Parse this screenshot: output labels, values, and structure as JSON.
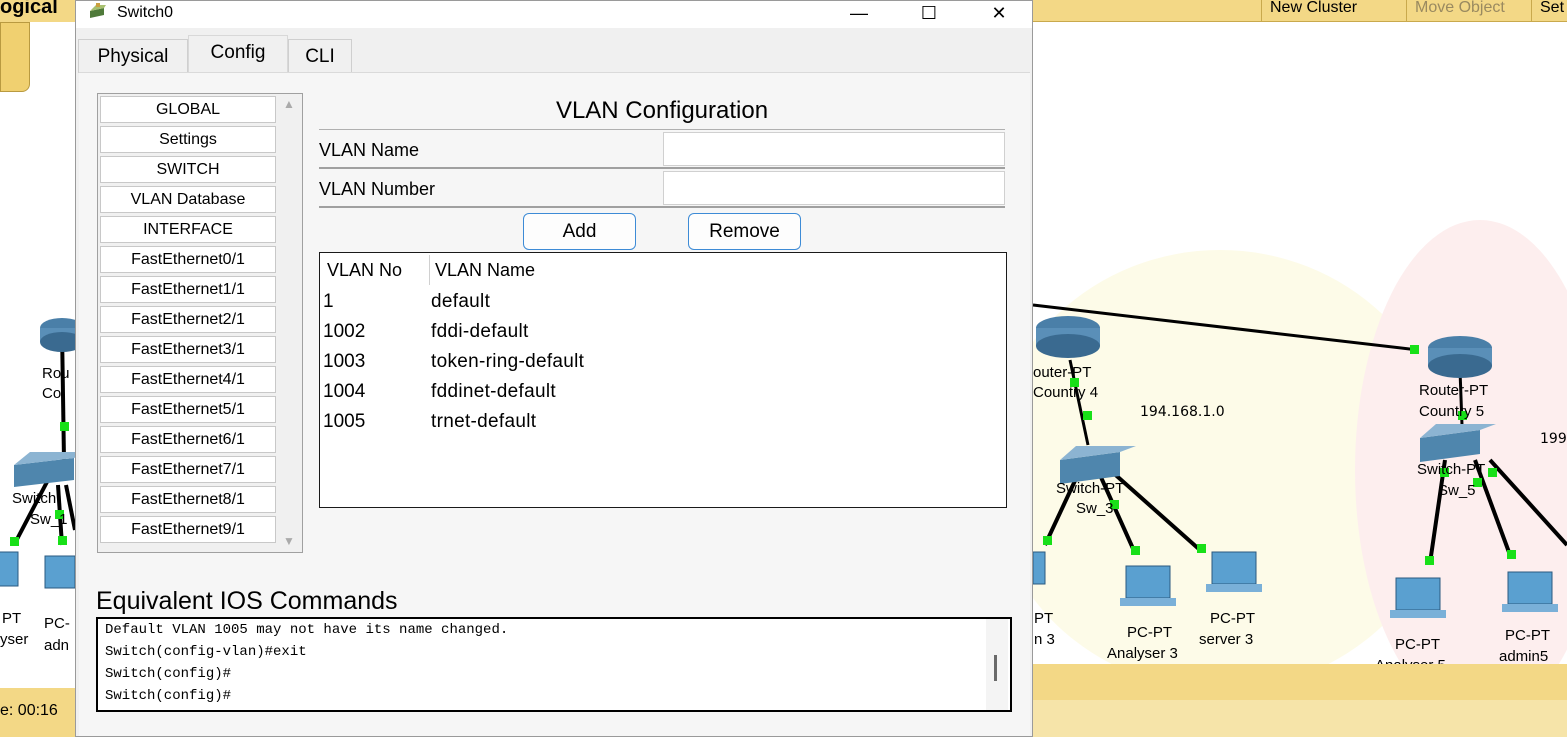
{
  "background": {
    "logical_label": "ogical",
    "topbar": {
      "new_cluster": "New Cluster",
      "move_object": "Move Object",
      "set": "Set"
    },
    "time_label": "e: 00:16",
    "labels_left": {
      "router_partial_1": "Rou",
      "router_partial_2": "Co",
      "switch_partial_1": "Switch",
      "switch_partial_2": "Sw_1",
      "pc_partial_1": "PT",
      "pc_partial_2": "yser",
      "pc_partial_3": "PC-",
      "pc_partial_4": "adn"
    },
    "labels_right": {
      "router4_a": "outer-PT",
      "router4_b": "Country 4",
      "net_194": "194.168.1.0",
      "switch3_a": "Switch-PT",
      "switch3_b": "Sw_3",
      "pc_left_a": "PT",
      "pc_left_b": "n 3",
      "pc_analyser3_a": "PC-PT",
      "pc_analyser3_b": "Analyser 3",
      "pc_server3_a": "PC-PT",
      "pc_server3_b": "server 3",
      "router5_a": "Router-PT",
      "router5_b": "Country 5",
      "net_199": "199",
      "switch5_a": "Switch-PT",
      "switch5_b": "Sw_5",
      "pc_analyser5_a": "PC-PT",
      "pc_analyser5_b": "Analyser 5",
      "pc_admin5_a": "PC-PT",
      "pc_admin5_b": "admin5"
    }
  },
  "window": {
    "title": "Switch0",
    "controls": {
      "minimize": "—",
      "maximize": "☐",
      "close": "✕"
    }
  },
  "tabs": [
    {
      "label": "Physical",
      "active": false
    },
    {
      "label": "Config",
      "active": true
    },
    {
      "label": "CLI",
      "active": false
    }
  ],
  "nav": {
    "items": [
      "GLOBAL",
      "Settings",
      "SWITCH",
      "VLAN Database",
      "INTERFACE",
      "FastEthernet0/1",
      "FastEthernet1/1",
      "FastEthernet2/1",
      "FastEthernet3/1",
      "FastEthernet4/1",
      "FastEthernet5/1",
      "FastEthernet6/1",
      "FastEthernet7/1",
      "FastEthernet8/1",
      "FastEthernet9/1"
    ]
  },
  "vlan_config": {
    "title": "VLAN Configuration",
    "name_label": "VLAN Name",
    "name_value": "",
    "number_label": "VLAN Number",
    "number_value": "",
    "add_label": "Add",
    "remove_label": "Remove",
    "table": {
      "columns": [
        "VLAN No",
        "VLAN Name"
      ],
      "rows": [
        {
          "no": "1",
          "name": "default"
        },
        {
          "no": "1002",
          "name": "fddi-default"
        },
        {
          "no": "1003",
          "name": "token-ring-default"
        },
        {
          "no": "1004",
          "name": "fddinet-default"
        },
        {
          "no": "1005",
          "name": "trnet-default"
        }
      ]
    }
  },
  "ios": {
    "title": "Equivalent IOS Commands",
    "lines": [
      "Default VLAN 1005 may not have its name changed.",
      "Switch(config-vlan)#exit",
      "Switch(config)#",
      "Switch(config)#"
    ]
  },
  "colors": {
    "accent_blue": "#3d8bd6",
    "workspace_yellow": "#f3d886",
    "link_green": "#18e018",
    "router_blue": "#5a8fb8"
  }
}
